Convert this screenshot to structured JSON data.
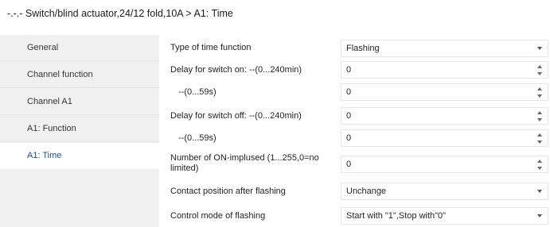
{
  "window": {
    "title": "-.-.- Switch/blind actuator,24/12 fold,10A > A1: Time"
  },
  "sidebar": {
    "items": [
      {
        "label": "General"
      },
      {
        "label": "Channel function"
      },
      {
        "label": "Channel A1"
      },
      {
        "label": "A1: Function"
      },
      {
        "label": "A1: Time",
        "active": true
      }
    ]
  },
  "params": [
    {
      "label": "Type of time function",
      "value": "Flashing",
      "control": "dropdown"
    },
    {
      "label": "Delay for switch on:   --(0...240min)",
      "value": "0",
      "control": "spinner"
    },
    {
      "label": "--(0...59s)",
      "value": "0",
      "control": "spinner"
    },
    {
      "label": "Delay for switch off:   --(0...240min)",
      "value": "0",
      "control": "spinner"
    },
    {
      "label": "--(0...59s)",
      "value": "0",
      "control": "spinner"
    },
    {
      "label": "Number of ON-implused (1...255,0=no limited)",
      "value": "0",
      "control": "spinner"
    },
    {
      "label": "Contact position after flashing",
      "value": "Unchange",
      "control": "dropdown"
    },
    {
      "label": "Control mode of flashing",
      "value": "Start with \"1\",Stop with\"0\"",
      "control": "dropdown"
    }
  ],
  "colors": {
    "sidebar_bg": "#f0f0f0",
    "active_text": "#1f4f86",
    "field_border": "#e6e6e6"
  }
}
